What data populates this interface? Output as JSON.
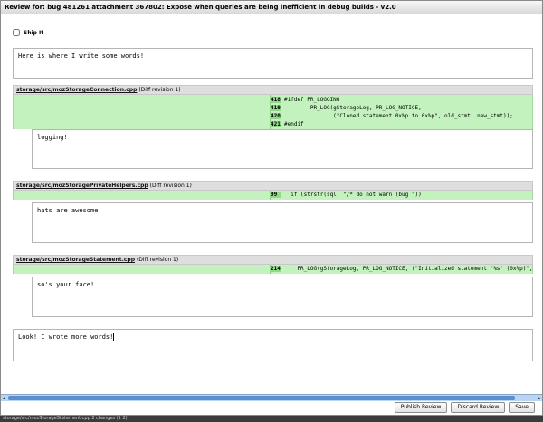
{
  "dialog": {
    "title": "Review for: bug 481261 attachment 367802: Expose when queries are being inefficient in debug builds - v2.0"
  },
  "ship_it": {
    "label": "Ship It",
    "checked": false
  },
  "review_body_top": {
    "value": "Here is where I write some words!"
  },
  "files": [
    {
      "name": "storage/src/mozStorageConnection.cpp",
      "revision": "(Diff revision 1)",
      "lines": [
        {
          "num": "418",
          "code": "#ifdef PR_LOGGING"
        },
        {
          "num": "419",
          "code": "        PR_LOG(gStorageLog, PR_LOG_NOTICE,"
        },
        {
          "num": "420",
          "code": "               (\"Cloned statement 0x%p to 0x%p\", old_stmt, new_stmt));"
        },
        {
          "num": "421",
          "code": "#endif"
        }
      ],
      "comment": "logging!"
    },
    {
      "name": "storage/src/mozStoragePrivateHelpers.cpp",
      "revision": "(Diff revision 1)",
      "lines": [
        {
          "num": "99",
          "code": "  if (strstr(sql, \"/* do not warn (bug \"))"
        }
      ],
      "comment": "hats are awesome!"
    },
    {
      "name": "storage/src/mozStorageStatement.cpp",
      "revision": "(Diff revision 1)",
      "lines": [
        {
          "num": "214",
          "code": "    PR_LOG(gStorageLog, PR_LOG_NOTICE, (\"Initialized statement '%s' (0x%p)\","
        }
      ],
      "comment": "so's your face!"
    }
  ],
  "review_body_bottom": {
    "value": "Look! I wrote more words!"
  },
  "buttons": {
    "publish": "Publish Review",
    "discard": "Discard Review",
    "save": "Save"
  },
  "statusbar": {
    "text": "storage/src/mozStorageStatement.cpp  2 changes (1 2)"
  }
}
